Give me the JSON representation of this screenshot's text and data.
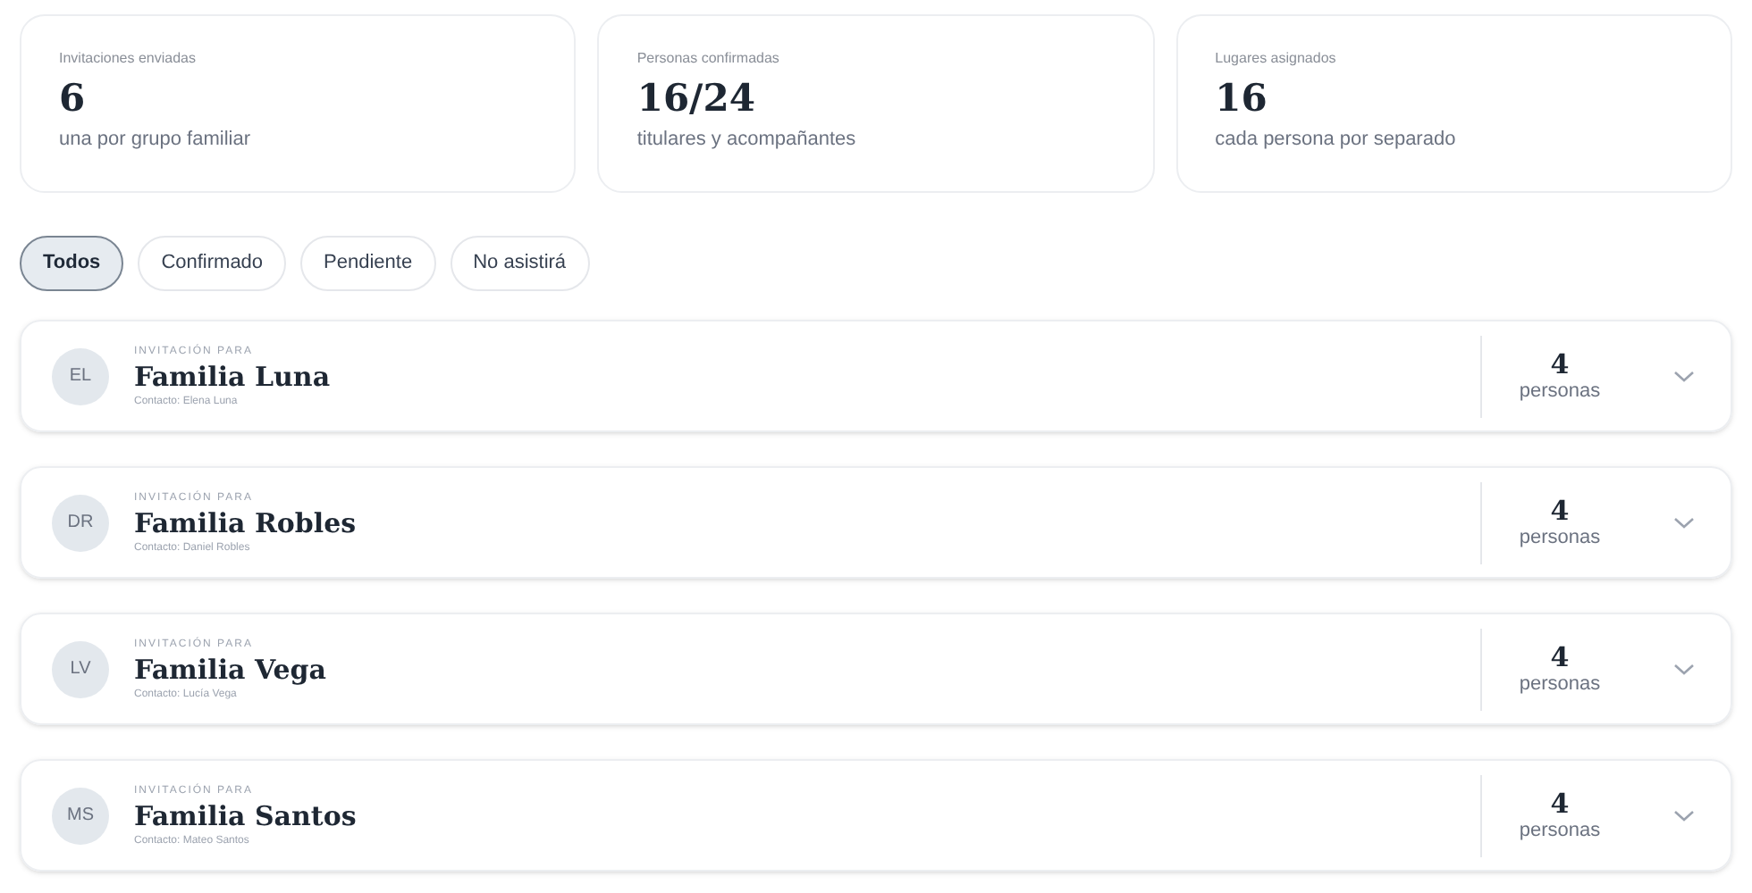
{
  "stats": [
    {
      "label": "Invitaciones enviadas",
      "value": "6",
      "note": "una por grupo familiar"
    },
    {
      "label": "Personas confirmadas",
      "value": "16/24",
      "note": "titulares y acompañantes"
    },
    {
      "label": "Lugares asignados",
      "value": "16",
      "note": "cada persona por separado"
    }
  ],
  "filters": [
    {
      "label": "Todos",
      "selected": true
    },
    {
      "label": "Confirmado",
      "selected": false
    },
    {
      "label": "Pendiente",
      "selected": false
    },
    {
      "label": "No asistirá",
      "selected": false
    }
  ],
  "invitations": [
    {
      "initials": "EL",
      "eyebrow": "INVITACIÓN PARA",
      "name": "Familia Luna",
      "contact": "Contacto: Elena Luna",
      "count": "4",
      "unit": "personas",
      "expanded": false
    },
    {
      "initials": "DR",
      "eyebrow": "INVITACIÓN PARA",
      "name": "Familia Robles",
      "contact": "Contacto: Daniel Robles",
      "count": "4",
      "unit": "personas",
      "expanded": false
    },
    {
      "initials": "LV",
      "eyebrow": "INVITACIÓN PARA",
      "name": "Familia Vega",
      "contact": "Contacto: Lucía Vega",
      "count": "4",
      "unit": "personas",
      "expanded": false
    },
    {
      "initials": "MS",
      "eyebrow": "INVITACIÓN PARA",
      "name": "Familia Santos",
      "contact": "Contacto: Mateo Santos",
      "count": "4",
      "unit": "personas",
      "expanded": false
    }
  ]
}
